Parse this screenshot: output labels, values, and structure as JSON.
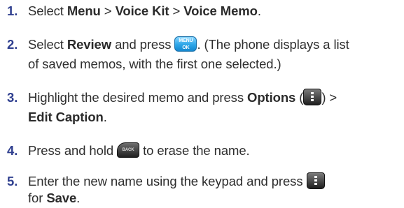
{
  "steps": [
    {
      "number": "1.",
      "t1": "Select ",
      "b1": "Menu",
      "t2": " > ",
      "b2": "Voice Kit",
      "t3": " > ",
      "b3": "Voice Memo",
      "t4": "."
    },
    {
      "number": "2.",
      "t1": "Select ",
      "b1": "Review",
      "t2": " and press ",
      "key": {
        "icon": "menu-ok-key-icon",
        "line1": "MENU",
        "line2": "OK"
      },
      "t3": ". (The phone displays a list",
      "line2": "of saved memos, with the first one selected.)"
    },
    {
      "number": "3.",
      "t1": "Highlight the desired memo and press ",
      "b1": "Options",
      "t2": " (",
      "key": {
        "icon": "right-softkey-icon"
      },
      "t3": ") >",
      "b2": "Edit Caption",
      "t4": "."
    },
    {
      "number": "4.",
      "t1": "Press and hold ",
      "key": {
        "icon": "back-key-icon",
        "label": "BACK"
      },
      "t2": " to erase the name."
    },
    {
      "number": "5.",
      "t1": "Enter the new name using the keypad and press ",
      "key": {
        "icon": "right-softkey-icon"
      },
      "t2": "for ",
      "b1": "Save",
      "t3": "."
    }
  ],
  "colors": {
    "number": "#2f3f8f",
    "text": "#2e2e2e",
    "menu_key": "#2da6e8",
    "dark_key": "#1e1e1e"
  }
}
